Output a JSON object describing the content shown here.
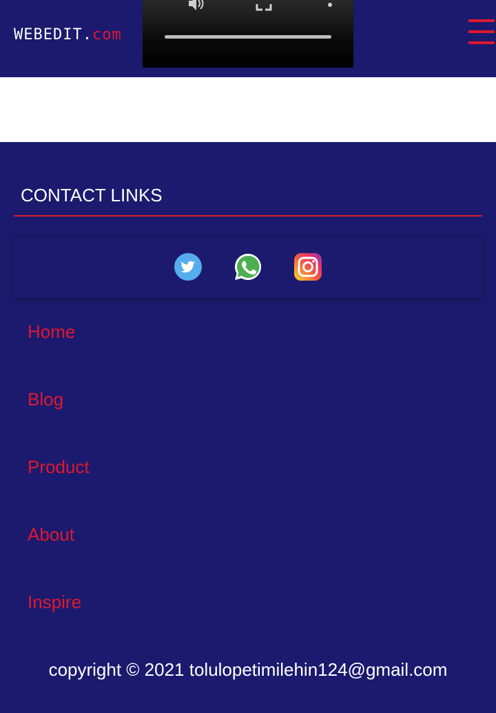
{
  "header": {
    "logo_main": "WEBEDIT.",
    "logo_tld": "com"
  },
  "contact": {
    "title": "CONTACT LINKS",
    "socials": [
      {
        "icon": "twitter-icon",
        "color": "#55acee"
      },
      {
        "icon": "whatsapp-icon",
        "color": "#4caf50"
      },
      {
        "icon": "instagram-icon",
        "color": "#e1306c"
      }
    ]
  },
  "nav": {
    "items": [
      "Home",
      "Blog",
      "Product",
      "About",
      "Inspire"
    ]
  },
  "footer": {
    "copyright": "copyright © 2021 tolulopetimilehin124@gmail.com"
  },
  "colors": {
    "background": "#1b1a6e",
    "accent": "#e0182e",
    "text": "#ffffff"
  }
}
